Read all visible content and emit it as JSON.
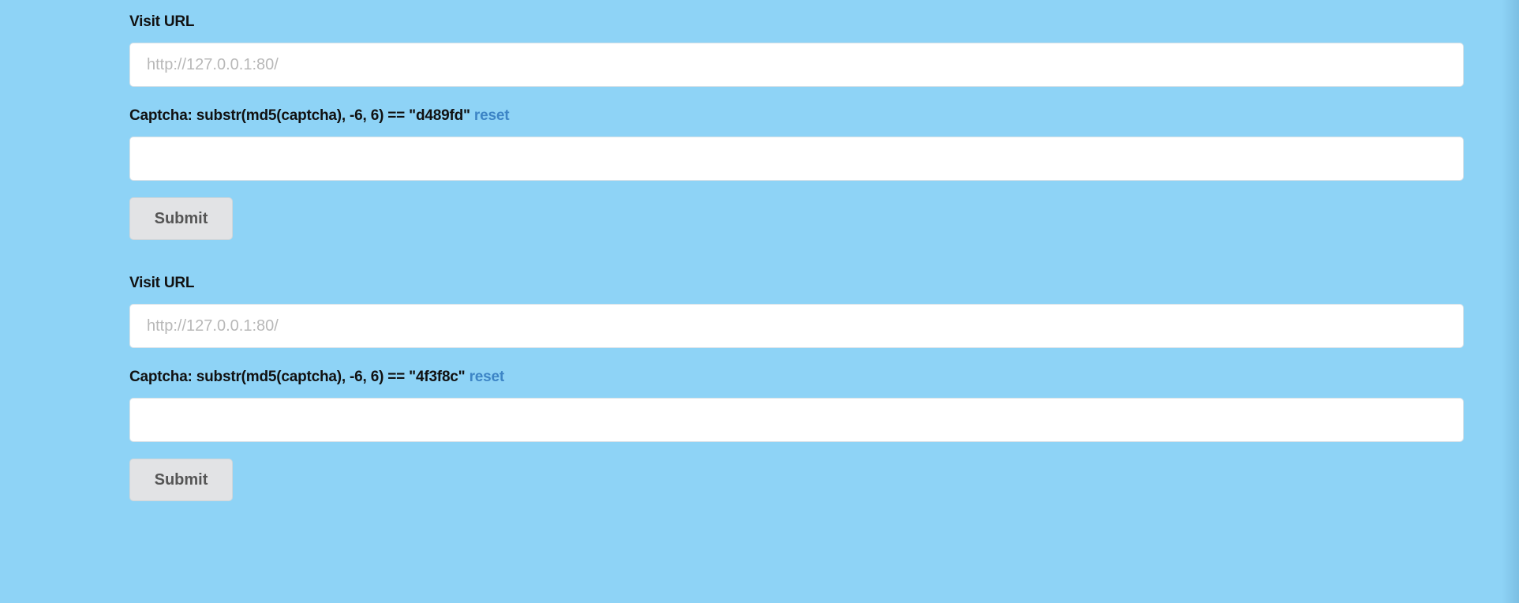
{
  "forms": [
    {
      "url_label": "Visit URL",
      "url_placeholder": "http://127.0.0.1:80/",
      "url_value": "",
      "captcha_label": "Captcha: substr(md5(captcha), -6, 6) == \"d489fd\"",
      "reset_label": "reset",
      "captcha_value": "",
      "submit_label": "Submit"
    },
    {
      "url_label": "Visit URL",
      "url_placeholder": "http://127.0.0.1:80/",
      "url_value": "",
      "captcha_label": "Captcha: substr(md5(captcha), -6, 6) == \"4f3f8c\"",
      "reset_label": "reset",
      "captcha_value": "",
      "submit_label": "Submit"
    }
  ],
  "colors": {
    "background": "#8ed3f6",
    "link": "#3d85c6",
    "button": "#e2e3e5",
    "input": "#ffffff"
  }
}
